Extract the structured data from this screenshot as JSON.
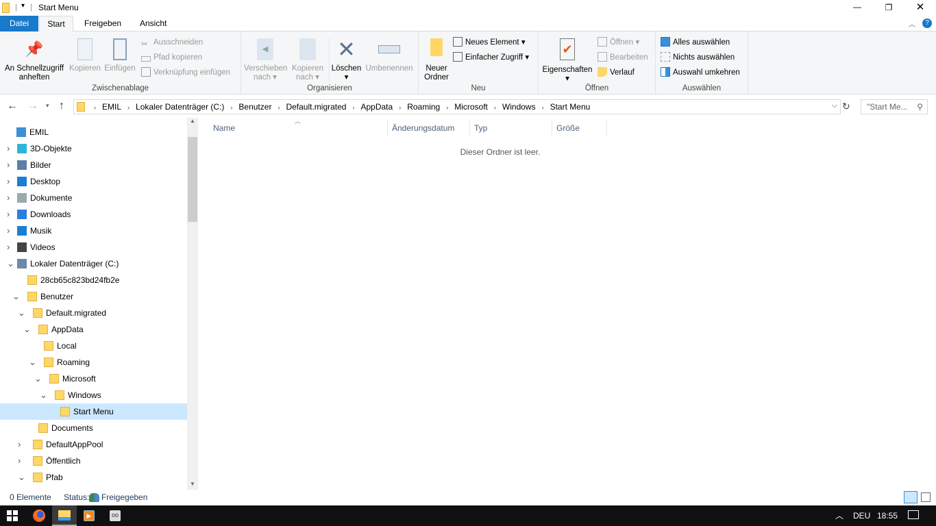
{
  "window": {
    "title": "Start Menu"
  },
  "tabs": [
    "Datei",
    "Start",
    "Freigeben",
    "Ansicht"
  ],
  "ribbon": {
    "zwischenablage": {
      "label": "Zwischenablage",
      "pin": "An Schnellzugriff anheften",
      "copy": "Kopieren",
      "paste": "Einfügen",
      "cut": "Ausschneiden",
      "copy_path": "Pfad kopieren",
      "paste_link": "Verknüpfung einfügen"
    },
    "organisieren": {
      "label": "Organisieren",
      "move": "Verschieben nach",
      "copyto": "Kopieren nach",
      "delete": "Löschen",
      "rename": "Umbenennen"
    },
    "neu": {
      "label": "Neu",
      "new_folder": "Neuer Ordner",
      "new_item": "Neues Element",
      "easy_access": "Einfacher Zugriff"
    },
    "oeffnen": {
      "label": "Öffnen",
      "properties": "Eigenschaften",
      "open": "Öffnen",
      "edit": "Bearbeiten",
      "history": "Verlauf"
    },
    "auswaehlen": {
      "label": "Auswählen",
      "all": "Alles auswählen",
      "none": "Nichts auswählen",
      "invert": "Auswahl umkehren"
    }
  },
  "address": {
    "crumbs": [
      "EMIL",
      "Lokaler Datenträger (C:)",
      "Benutzer",
      "Default.migrated",
      "AppData",
      "Roaming",
      "Microsoft",
      "Windows",
      "Start Menu"
    ],
    "search_placeholder": "\"Start Me..."
  },
  "tree": [
    {
      "label": "EMIL",
      "level": 0,
      "chev": "",
      "icon": "pc"
    },
    {
      "label": "3D-Objekte",
      "level": 1,
      "chev": ">",
      "icon": "3d"
    },
    {
      "label": "Bilder",
      "level": 1,
      "chev": ">",
      "icon": "pics"
    },
    {
      "label": "Desktop",
      "level": 1,
      "chev": ">",
      "icon": "desk"
    },
    {
      "label": "Dokumente",
      "level": 1,
      "chev": ">",
      "icon": "docs"
    },
    {
      "label": "Downloads",
      "level": 1,
      "chev": ">",
      "icon": "down"
    },
    {
      "label": "Musik",
      "level": 1,
      "chev": ">",
      "icon": "music"
    },
    {
      "label": "Videos",
      "level": 1,
      "chev": ">",
      "icon": "vid"
    },
    {
      "label": "Lokaler Datenträger (C:)",
      "level": 1,
      "chev": "v",
      "icon": "drive"
    },
    {
      "label": "28cb65c823bd24fb2e",
      "level": 2,
      "chev": "",
      "icon": "folder"
    },
    {
      "label": "Benutzer",
      "level": 2,
      "chev": "v",
      "icon": "folder"
    },
    {
      "label": "Default.migrated",
      "level": 3,
      "chev": "v",
      "icon": "folder"
    },
    {
      "label": "AppData",
      "level": 4,
      "chev": "v",
      "icon": "folder"
    },
    {
      "label": "Local",
      "level": 5,
      "chev": "",
      "icon": "folder"
    },
    {
      "label": "Roaming",
      "level": 5,
      "chev": "v",
      "icon": "folder"
    },
    {
      "label": "Microsoft",
      "level": 6,
      "chev": "v",
      "icon": "folder"
    },
    {
      "label": "Windows",
      "level": 7,
      "chev": "v",
      "icon": "folder"
    },
    {
      "label": "Start Menu",
      "level": 8,
      "chev": "",
      "icon": "folder",
      "selected": true
    },
    {
      "label": "Documents",
      "level": 4,
      "chev": "",
      "icon": "folder"
    },
    {
      "label": "DefaultAppPool",
      "level": 3,
      "chev": ">",
      "icon": "folder"
    },
    {
      "label": "Öffentlich",
      "level": 3,
      "chev": ">",
      "icon": "folder"
    },
    {
      "label": "Pfab",
      "level": 3,
      "chev": "v",
      "icon": "folder"
    }
  ],
  "columns": [
    "Name",
    "Änderungsdatum",
    "Typ",
    "Größe"
  ],
  "empty_message": "Dieser Ordner ist leer.",
  "status": {
    "count": "0 Elemente",
    "status_label": "Status:",
    "status_value": "Freigegeben"
  },
  "taskbar": {
    "lang": "DEU",
    "time": "18:55"
  },
  "colors": {
    "accent": "#1979ca",
    "selection": "#cce8ff",
    "folder": "#ffd766"
  }
}
